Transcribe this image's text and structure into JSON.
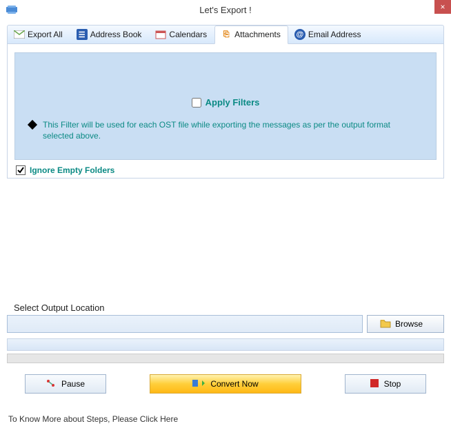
{
  "title": "Let's Export !",
  "close_icon": "×",
  "tabs": [
    {
      "label": "Export All"
    },
    {
      "label": "Address Book"
    },
    {
      "label": "Calendars"
    },
    {
      "label": "Attachments"
    },
    {
      "label": "Email Address"
    }
  ],
  "filter": {
    "apply_label": "Apply Filters",
    "desc": "This Filter will be used for each OST file while exporting the messages as per the output format selected above."
  },
  "ignore_label": "Ignore Empty Folders",
  "output": {
    "label": "Select Output Location",
    "value": "",
    "browse": "Browse"
  },
  "actions": {
    "pause": "Pause",
    "convert": "Convert Now",
    "stop": "Stop"
  },
  "footer": "To Know More about Steps, Please Click Here"
}
